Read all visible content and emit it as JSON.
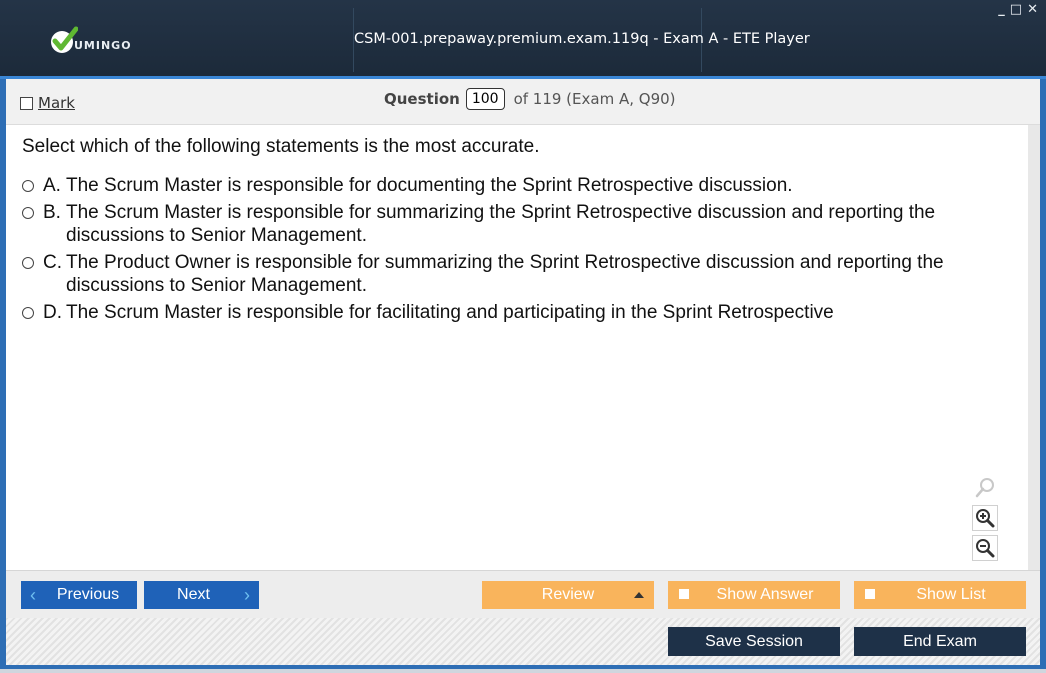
{
  "app": {
    "logo_text": "UMINGO",
    "window_title": "CSM-001.prepaway.premium.exam.119q - Exam A - ETE Player",
    "controls": {
      "minimize": "_",
      "maximize": "□",
      "close": "✕"
    }
  },
  "toolbar": {
    "mark_label": "Mark",
    "question_label": "Question",
    "question_number": "100",
    "question_of": "of 119 (Exam A, Q90)"
  },
  "question": {
    "prompt": "Select which of the following statements is the most accurate.",
    "options": [
      {
        "letter": "A.",
        "text": "The Scrum Master is responsible for documenting the Sprint Retrospective discussion."
      },
      {
        "letter": "B.",
        "text": "The Scrum Master is responsible for summarizing the Sprint Retrospective discussion and reporting the discussions to Senior Management."
      },
      {
        "letter": "C.",
        "text": "The Product Owner is responsible for summarizing the Sprint Retrospective discussion and reporting the discussions to Senior Management."
      },
      {
        "letter": "D.",
        "text": "The Scrum Master is responsible for facilitating and participating in the Sprint Retrospective"
      }
    ]
  },
  "nav": {
    "previous": "Previous",
    "next": "Next",
    "review": "Review",
    "show_answer": "Show Answer",
    "show_list": "Show List",
    "save_session": "Save Session",
    "end_exam": "End Exam"
  },
  "colors": {
    "titlebar": "#1f2e40",
    "accent_blue": "#1f62b8",
    "orange": "#f9b45c",
    "dark_button": "#1e3148",
    "logo_green": "#5fb832"
  }
}
